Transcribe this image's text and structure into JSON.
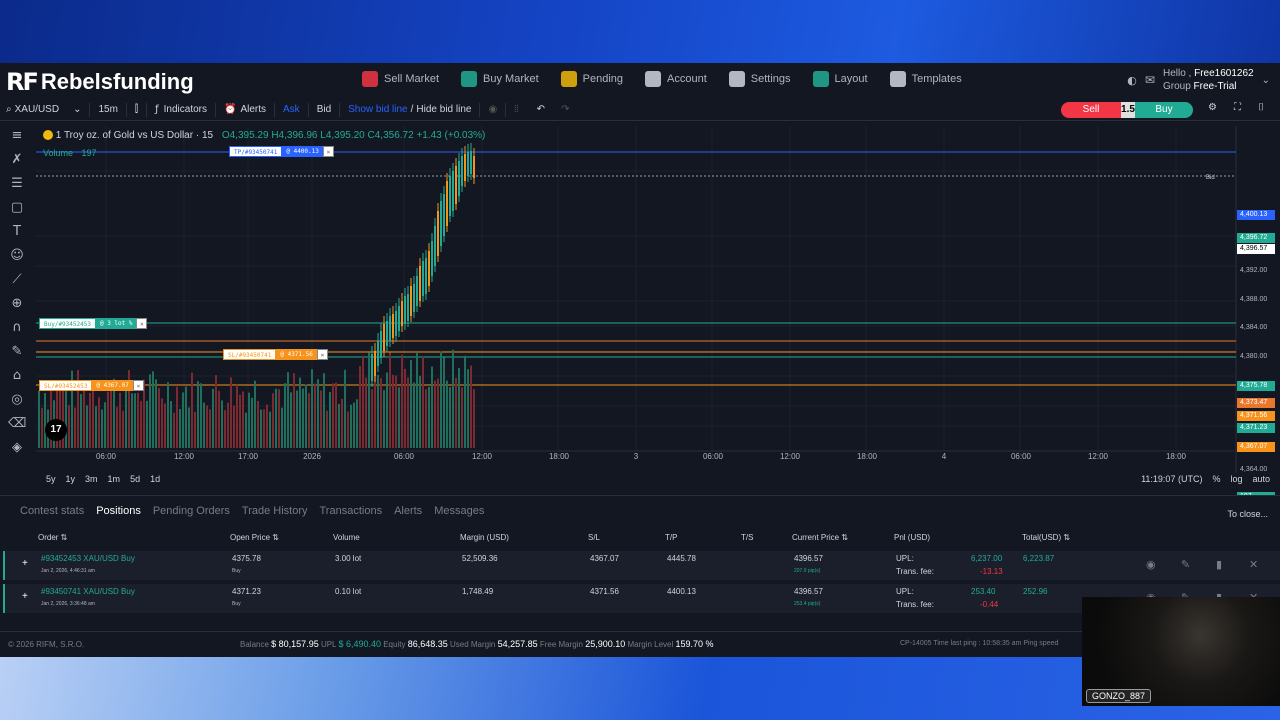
{
  "header": {
    "logo_mark": "RF",
    "brand": "Rebelsfunding",
    "nav": [
      {
        "label": "Sell Market",
        "icon": "sell-market-icon",
        "color": "#f23645"
      },
      {
        "label": "Buy Market",
        "icon": "buy-market-icon",
        "color": "#22ab94"
      },
      {
        "label": "Pending",
        "icon": "pending-clock-icon",
        "color": "#f0b90b"
      },
      {
        "label": "Account",
        "icon": "account-person-icon",
        "color": "#d1d4dc"
      },
      {
        "label": "Settings",
        "icon": "settings-wrench-icon",
        "color": "#d1d4dc"
      },
      {
        "label": "Layout",
        "icon": "layout-icon",
        "color": "#22ab94"
      },
      {
        "label": "Templates",
        "icon": "templates-icon",
        "color": "#d1d4dc"
      }
    ],
    "hello": "Hello ,",
    "username": "Free1601262",
    "group_label": "Group",
    "group": "Free-Trial"
  },
  "toolbar": {
    "symbol": "XAU/USD",
    "interval": "15m",
    "indicators": "Indicators",
    "alerts": "Alerts",
    "ask": "Ask",
    "bid": "Bid",
    "show_bid_line": "Show bid line",
    "slash": "/",
    "hide_bid_line": "Hide bid line",
    "sell": "Sell",
    "spread": "1.5",
    "buy": "Buy"
  },
  "chart": {
    "legend_title": "1 Troy oz. of Gold vs US Dollar · 15",
    "legend_values": "O4,395.29  H4,396.96  L4,395.20  C4,356.72  +1.43 (+0.03%)",
    "volume_label": "Volume",
    "volume_value": "197",
    "bid_text": "Bid",
    "y_ticks": [
      "4,392.00",
      "4,388.00",
      "4,384.00",
      "4,380.00",
      "4,364.00"
    ],
    "x_ticks": [
      "06:00",
      "12:00",
      "17:00",
      "2026",
      "06:00",
      "12:00",
      "18:00",
      "3",
      "06:00",
      "12:00",
      "18:00",
      "4",
      "06:00",
      "12:00",
      "18:00"
    ],
    "price_labels": [
      {
        "text": "4,400.13",
        "color": "#2962ff"
      },
      {
        "text": "4,396.72",
        "color": "#22ab94"
      },
      {
        "text": "4,396.57",
        "color": "#ffffff"
      },
      {
        "text": "4,375.78",
        "color": "#22ab94"
      },
      {
        "text": "4,373.47",
        "color": "#e8772e"
      },
      {
        "text": "4,371.56",
        "color": "#f7931a"
      },
      {
        "text": "4,371.23",
        "color": "#22ab94"
      },
      {
        "text": "4,367.07",
        "color": "#f7931a"
      },
      {
        "text": "197",
        "color": "#22ab94"
      }
    ],
    "tags": [
      {
        "left": "TP/#93450741",
        "right": "@ 4400.13",
        "color": "#2962ff"
      },
      {
        "left": "Buy/#93452453",
        "right": "@ 3 lot %",
        "color": "#22ab94"
      },
      {
        "left": "SL/#93450741",
        "right": "@ 4371.56",
        "color": "#f7931a"
      },
      {
        "left": "SL/#93452453",
        "right": "@ 4367.07",
        "color": "#f7931a"
      }
    ],
    "tv_logo": "17"
  },
  "range": {
    "items": [
      "5y",
      "1y",
      "3m",
      "1m",
      "5d",
      "1d"
    ],
    "time": "11:19:07 (UTC)",
    "percent": "%",
    "log": "log",
    "auto": "auto"
  },
  "panel": {
    "tabs": [
      "Contest stats",
      "Positions",
      "Pending Orders",
      "Trade History",
      "Transactions",
      "Alerts",
      "Messages"
    ],
    "close_all": "To close...",
    "headers": {
      "order": "Order ⇅",
      "open_price": "Open Price ⇅",
      "volume": "Volume",
      "margin": "Margin (USD)",
      "sl": "S/L",
      "tp": "T/P",
      "ts": "T/S",
      "current_price": "Current Price ⇅",
      "pnl": "Pnl (USD)",
      "total": "Total(USD) ⇅"
    },
    "rows": [
      {
        "order": "#93452453 XAU/USD Buy",
        "date": "Jan 2, 2026, 4:46:31 am",
        "open_price": "4375.78",
        "side": "Buy",
        "volume": "3.00 lot",
        "margin": "52,509.36",
        "sl": "4367.07",
        "tp": "4445.78",
        "current_price": "4396.57",
        "pips": "207.9 pip(s)",
        "upl_label": "UPL:",
        "upl": "6,237.00",
        "fee_label": "Trans. fee:",
        "fee": "-13.13",
        "total": "6,223.87"
      },
      {
        "order": "#93450741 XAU/USD Buy",
        "date": "Jan 2, 2026, 3:36:48 am",
        "open_price": "4371.23",
        "side": "Buy",
        "volume": "0.10 lot",
        "margin": "1,748.49",
        "sl": "4371.56",
        "tp": "4400.13",
        "current_price": "4396.57",
        "pips": "253.4 pip(s)",
        "upl_label": "UPL:",
        "upl": "253.40",
        "fee_label": "Trans. fee:",
        "fee": "-0.44",
        "total": "252.96"
      }
    ]
  },
  "footer": {
    "copyright": "© 2026 RIFM, S.R.O.",
    "balance_label": "Balance",
    "balance": "$ 80,157.95",
    "upl_label": "UPL",
    "upl": "$ 6,490.40",
    "equity_label": "Equity",
    "equity": "86,648.35",
    "used_margin_label": "Used Margin",
    "used_margin": "54,257.85",
    "free_margin_label": "Free Margin",
    "free_margin": "25,900.10",
    "margin_level_label": "Margin Level",
    "margin_level": "159.70 %",
    "ping": "CP-14005 Time last ping : 10:58:35 am   Ping speed"
  },
  "webcam": {
    "name": "GONZO_887"
  }
}
